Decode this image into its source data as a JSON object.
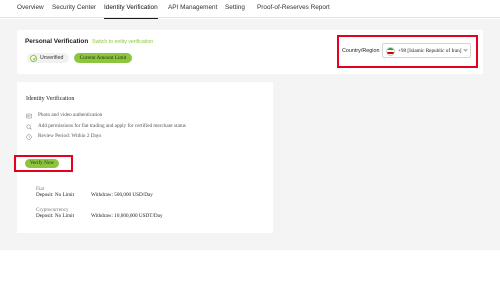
{
  "nav": {
    "tabs": [
      {
        "label": "Overview"
      },
      {
        "label": "Security Center"
      },
      {
        "label": "Identity Verification"
      },
      {
        "label": "API Management"
      },
      {
        "label": "Setting"
      },
      {
        "label": "Proof-of-Reserves Report"
      }
    ],
    "active_tab": "Identity Verification"
  },
  "personal_verification": {
    "title": "Personal Verification",
    "switch_link": "Switch to entity verification",
    "status_chip": "Unverified",
    "limit_button": "Current Amount Limit",
    "country_label": "Country/Region",
    "country_value": "+98 [Islamic Republic of Iran] [Isl...",
    "country_flag": "iran-flag-icon"
  },
  "identity_verification": {
    "title": "Identity Verification",
    "features": [
      {
        "icon": "id-card-icon",
        "text": "Photo and video authentication"
      },
      {
        "icon": "search-icon",
        "text": "Add permissions for fiat trading and apply for certified merchant status"
      },
      {
        "icon": "clock-icon",
        "text": "Review Period: Within 2 Days"
      }
    ],
    "verify_button": "Verify Now",
    "limits": [
      {
        "label": "Fiat",
        "deposit": "Deposit: No Limit",
        "withdraw": "Withdraw: 500,000 USD/Day"
      },
      {
        "label": "Cryptocurrency",
        "deposit": "Deposit: No Limit",
        "withdraw": "Withdraw: 10,000,000 USDT/Day"
      }
    ]
  },
  "colors": {
    "accent": "#8cc63f",
    "highlight_border": "#e6001f",
    "background": "#f4f4f4"
  }
}
